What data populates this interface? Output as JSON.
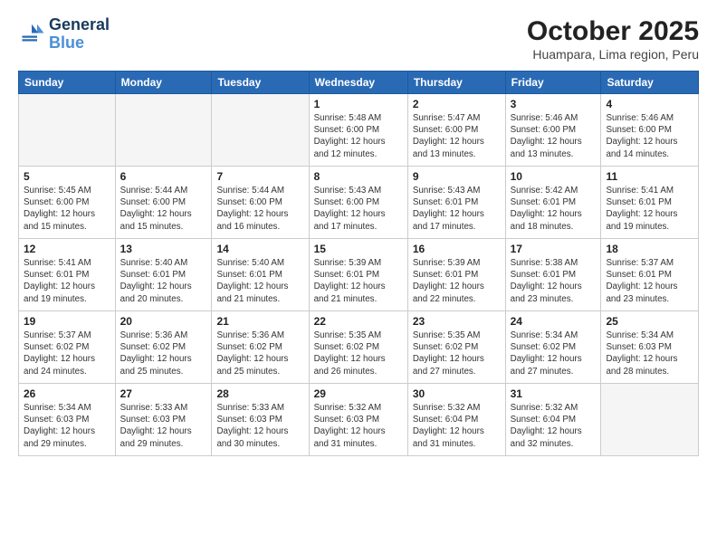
{
  "header": {
    "logo_line1": "General",
    "logo_line2": "Blue",
    "month": "October 2025",
    "location": "Huampara, Lima region, Peru"
  },
  "weekdays": [
    "Sunday",
    "Monday",
    "Tuesday",
    "Wednesday",
    "Thursday",
    "Friday",
    "Saturday"
  ],
  "weeks": [
    [
      {
        "day": "",
        "info": ""
      },
      {
        "day": "",
        "info": ""
      },
      {
        "day": "",
        "info": ""
      },
      {
        "day": "1",
        "info": "Sunrise: 5:48 AM\nSunset: 6:00 PM\nDaylight: 12 hours\nand 12 minutes."
      },
      {
        "day": "2",
        "info": "Sunrise: 5:47 AM\nSunset: 6:00 PM\nDaylight: 12 hours\nand 13 minutes."
      },
      {
        "day": "3",
        "info": "Sunrise: 5:46 AM\nSunset: 6:00 PM\nDaylight: 12 hours\nand 13 minutes."
      },
      {
        "day": "4",
        "info": "Sunrise: 5:46 AM\nSunset: 6:00 PM\nDaylight: 12 hours\nand 14 minutes."
      }
    ],
    [
      {
        "day": "5",
        "info": "Sunrise: 5:45 AM\nSunset: 6:00 PM\nDaylight: 12 hours\nand 15 minutes."
      },
      {
        "day": "6",
        "info": "Sunrise: 5:44 AM\nSunset: 6:00 PM\nDaylight: 12 hours\nand 15 minutes."
      },
      {
        "day": "7",
        "info": "Sunrise: 5:44 AM\nSunset: 6:00 PM\nDaylight: 12 hours\nand 16 minutes."
      },
      {
        "day": "8",
        "info": "Sunrise: 5:43 AM\nSunset: 6:00 PM\nDaylight: 12 hours\nand 17 minutes."
      },
      {
        "day": "9",
        "info": "Sunrise: 5:43 AM\nSunset: 6:01 PM\nDaylight: 12 hours\nand 17 minutes."
      },
      {
        "day": "10",
        "info": "Sunrise: 5:42 AM\nSunset: 6:01 PM\nDaylight: 12 hours\nand 18 minutes."
      },
      {
        "day": "11",
        "info": "Sunrise: 5:41 AM\nSunset: 6:01 PM\nDaylight: 12 hours\nand 19 minutes."
      }
    ],
    [
      {
        "day": "12",
        "info": "Sunrise: 5:41 AM\nSunset: 6:01 PM\nDaylight: 12 hours\nand 19 minutes."
      },
      {
        "day": "13",
        "info": "Sunrise: 5:40 AM\nSunset: 6:01 PM\nDaylight: 12 hours\nand 20 minutes."
      },
      {
        "day": "14",
        "info": "Sunrise: 5:40 AM\nSunset: 6:01 PM\nDaylight: 12 hours\nand 21 minutes."
      },
      {
        "day": "15",
        "info": "Sunrise: 5:39 AM\nSunset: 6:01 PM\nDaylight: 12 hours\nand 21 minutes."
      },
      {
        "day": "16",
        "info": "Sunrise: 5:39 AM\nSunset: 6:01 PM\nDaylight: 12 hours\nand 22 minutes."
      },
      {
        "day": "17",
        "info": "Sunrise: 5:38 AM\nSunset: 6:01 PM\nDaylight: 12 hours\nand 23 minutes."
      },
      {
        "day": "18",
        "info": "Sunrise: 5:37 AM\nSunset: 6:01 PM\nDaylight: 12 hours\nand 23 minutes."
      }
    ],
    [
      {
        "day": "19",
        "info": "Sunrise: 5:37 AM\nSunset: 6:02 PM\nDaylight: 12 hours\nand 24 minutes."
      },
      {
        "day": "20",
        "info": "Sunrise: 5:36 AM\nSunset: 6:02 PM\nDaylight: 12 hours\nand 25 minutes."
      },
      {
        "day": "21",
        "info": "Sunrise: 5:36 AM\nSunset: 6:02 PM\nDaylight: 12 hours\nand 25 minutes."
      },
      {
        "day": "22",
        "info": "Sunrise: 5:35 AM\nSunset: 6:02 PM\nDaylight: 12 hours\nand 26 minutes."
      },
      {
        "day": "23",
        "info": "Sunrise: 5:35 AM\nSunset: 6:02 PM\nDaylight: 12 hours\nand 27 minutes."
      },
      {
        "day": "24",
        "info": "Sunrise: 5:34 AM\nSunset: 6:02 PM\nDaylight: 12 hours\nand 27 minutes."
      },
      {
        "day": "25",
        "info": "Sunrise: 5:34 AM\nSunset: 6:03 PM\nDaylight: 12 hours\nand 28 minutes."
      }
    ],
    [
      {
        "day": "26",
        "info": "Sunrise: 5:34 AM\nSunset: 6:03 PM\nDaylight: 12 hours\nand 29 minutes."
      },
      {
        "day": "27",
        "info": "Sunrise: 5:33 AM\nSunset: 6:03 PM\nDaylight: 12 hours\nand 29 minutes."
      },
      {
        "day": "28",
        "info": "Sunrise: 5:33 AM\nSunset: 6:03 PM\nDaylight: 12 hours\nand 30 minutes."
      },
      {
        "day": "29",
        "info": "Sunrise: 5:32 AM\nSunset: 6:03 PM\nDaylight: 12 hours\nand 31 minutes."
      },
      {
        "day": "30",
        "info": "Sunrise: 5:32 AM\nSunset: 6:04 PM\nDaylight: 12 hours\nand 31 minutes."
      },
      {
        "day": "31",
        "info": "Sunrise: 5:32 AM\nSunset: 6:04 PM\nDaylight: 12 hours\nand 32 minutes."
      },
      {
        "day": "",
        "info": ""
      }
    ]
  ]
}
